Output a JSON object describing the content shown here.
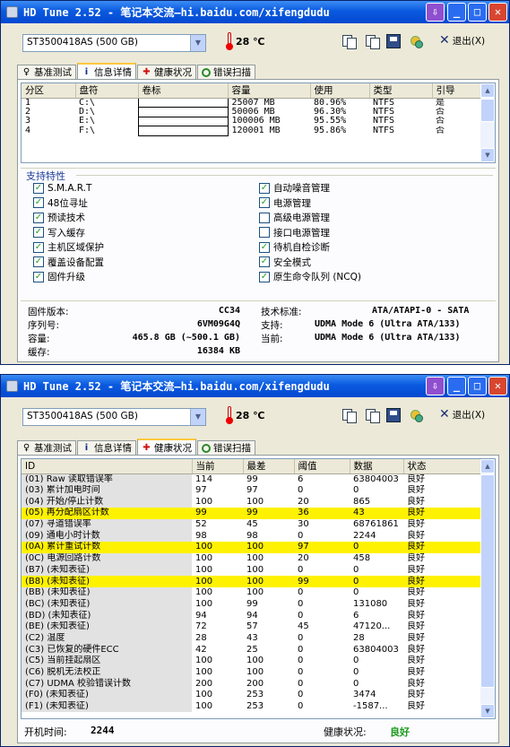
{
  "title_text": "HD Tune 2.52 - 笔记本交流—hi.baidu.com/xifengdudu",
  "drive": "ST3500418AS (500 GB)",
  "temp_value": "28",
  "temp_unit": "℃",
  "exit_label": "退出(X)",
  "tabs": [
    "基准测试",
    "信息详情",
    "健康状况",
    "错误扫描"
  ],
  "partitions": {
    "headers": [
      "分区",
      "盘符",
      "卷标",
      "容量",
      "使用",
      "类型",
      "引导"
    ],
    "rows": [
      [
        "1",
        "C:\\",
        "",
        "25007 MB",
        "80.96%",
        "NTFS",
        "是"
      ],
      [
        "2",
        "D:\\",
        "",
        "50006 MB",
        "96.30%",
        "NTFS",
        "否"
      ],
      [
        "3",
        "E:\\",
        "",
        "100006 MB",
        "95.55%",
        "NTFS",
        "否"
      ],
      [
        "4",
        "F:\\",
        "",
        "120001 MB",
        "95.86%",
        "NTFS",
        "否"
      ]
    ]
  },
  "features": {
    "heading": "支持特性",
    "left": [
      {
        "label": "S.M.A.R.T",
        "checked": true
      },
      {
        "label": "48位寻址",
        "checked": true
      },
      {
        "label": "预读技术",
        "checked": true
      },
      {
        "label": "写入缓存",
        "checked": true
      },
      {
        "label": "主机区域保护",
        "checked": true
      },
      {
        "label": "覆盖设备配置",
        "checked": true
      },
      {
        "label": "固件升级",
        "checked": true
      }
    ],
    "right": [
      {
        "label": "自动噪音管理",
        "checked": true
      },
      {
        "label": "电源管理",
        "checked": true
      },
      {
        "label": "高级电源管理",
        "checked": false
      },
      {
        "label": "接口电源管理",
        "checked": false
      },
      {
        "label": "待机自检诊断",
        "checked": true
      },
      {
        "label": "安全模式",
        "checked": true
      },
      {
        "label": "原生命令队列 (NCQ)",
        "checked": true
      }
    ]
  },
  "info": {
    "firmware_label": "固件版本:",
    "firmware": "CC34",
    "serial_label": "序列号:",
    "serial": "6VM09G4Q",
    "capacity_label": "容量:",
    "capacity": "465.8 GB (~500.1 GB)",
    "cache_label": "缓存:",
    "cache": "16384 KB",
    "standard_label": "技术标准:",
    "standard": "ATA/ATAPI-0 - SATA",
    "support_label": "支持:",
    "support": "UDMA Mode 6 (Ultra ATA/133)",
    "current_label": "当前:",
    "current": "UDMA Mode 6 (Ultra ATA/133)"
  },
  "health": {
    "headers": [
      "ID",
      "当前",
      "最差",
      "阈值",
      "数据",
      "状态"
    ],
    "rows": [
      {
        "id": "(01) Raw 读取错误率",
        "cur": "114",
        "worst": "99",
        "thr": "6",
        "data": "63804003",
        "status": "良好",
        "hl": false
      },
      {
        "id": "(03) 累计加电时间",
        "cur": "97",
        "worst": "97",
        "thr": "0",
        "data": "0",
        "status": "良好",
        "hl": false
      },
      {
        "id": "(04) 开始/停止计数",
        "cur": "100",
        "worst": "100",
        "thr": "20",
        "data": "865",
        "status": "良好",
        "hl": false
      },
      {
        "id": "(05) 再分配扇区计数",
        "cur": "99",
        "worst": "99",
        "thr": "36",
        "data": "43",
        "status": "良好",
        "hl": true
      },
      {
        "id": "(07) 寻道错误率",
        "cur": "52",
        "worst": "45",
        "thr": "30",
        "data": "68761861",
        "status": "良好",
        "hl": false
      },
      {
        "id": "(09) 通电小时计数",
        "cur": "98",
        "worst": "98",
        "thr": "0",
        "data": "2244",
        "status": "良好",
        "hl": false
      },
      {
        "id": "(0A) 累计重试计数",
        "cur": "100",
        "worst": "100",
        "thr": "97",
        "data": "0",
        "status": "良好",
        "hl": true
      },
      {
        "id": "(0C) 电源回路计数",
        "cur": "100",
        "worst": "100",
        "thr": "20",
        "data": "458",
        "status": "良好",
        "hl": false
      },
      {
        "id": "(B7) (未知表征)",
        "cur": "100",
        "worst": "100",
        "thr": "0",
        "data": "0",
        "status": "良好",
        "hl": false
      },
      {
        "id": "(B8) (未知表征)",
        "cur": "100",
        "worst": "100",
        "thr": "99",
        "data": "0",
        "status": "良好",
        "hl": true
      },
      {
        "id": "(BB) (未知表征)",
        "cur": "100",
        "worst": "100",
        "thr": "0",
        "data": "0",
        "status": "良好",
        "hl": false
      },
      {
        "id": "(BC) (未知表征)",
        "cur": "100",
        "worst": "99",
        "thr": "0",
        "data": "131080",
        "status": "良好",
        "hl": false
      },
      {
        "id": "(BD) (未知表征)",
        "cur": "94",
        "worst": "94",
        "thr": "0",
        "data": "6",
        "status": "良好",
        "hl": false
      },
      {
        "id": "(BE) (未知表征)",
        "cur": "72",
        "worst": "57",
        "thr": "45",
        "data": "47120...",
        "status": "良好",
        "hl": false
      },
      {
        "id": "(C2) 温度",
        "cur": "28",
        "worst": "43",
        "thr": "0",
        "data": "28",
        "status": "良好",
        "hl": false
      },
      {
        "id": "(C3) 已恢复的硬件ECC",
        "cur": "42",
        "worst": "25",
        "thr": "0",
        "data": "63804003",
        "status": "良好",
        "hl": false
      },
      {
        "id": "(C5) 当前挂起扇区",
        "cur": "100",
        "worst": "100",
        "thr": "0",
        "data": "0",
        "status": "良好",
        "hl": false
      },
      {
        "id": "(C6) 脱机无法校正",
        "cur": "100",
        "worst": "100",
        "thr": "0",
        "data": "0",
        "status": "良好",
        "hl": false
      },
      {
        "id": "(C7) UDMA 校验错误计数",
        "cur": "200",
        "worst": "200",
        "thr": "0",
        "data": "0",
        "status": "良好",
        "hl": false
      },
      {
        "id": "(F0) (未知表征)",
        "cur": "100",
        "worst": "253",
        "thr": "0",
        "data": "3474",
        "status": "良好",
        "hl": false
      },
      {
        "id": "(F1) (未知表征)",
        "cur": "100",
        "worst": "253",
        "thr": "0",
        "data": "-1587...",
        "status": "良好",
        "hl": false
      }
    ],
    "power_on_label": "开机时间:",
    "power_on": "2244",
    "status_label": "健康状况:",
    "status": "良好"
  },
  "colors": {
    "highlight": "#fff200",
    "good": "#1a9a1a",
    "titlebar": "#0a5ae0",
    "tab_accent": "#ffc83c"
  }
}
